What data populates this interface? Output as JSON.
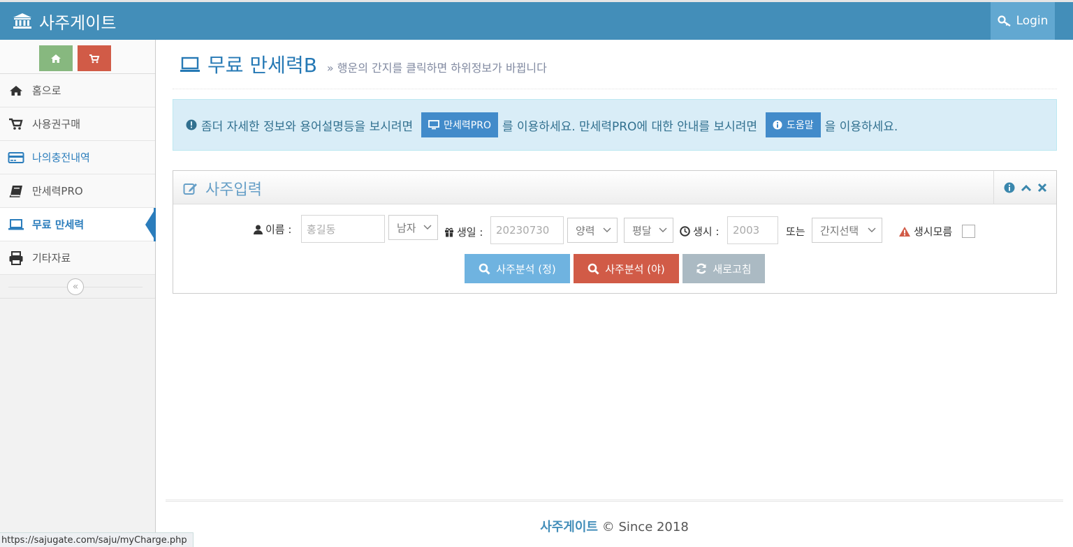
{
  "header": {
    "brand": "사주게이트",
    "login_label": "Login"
  },
  "sidebar": {
    "items": [
      {
        "label": "홈으로",
        "icon": "home-icon"
      },
      {
        "label": "사용권구매",
        "icon": "cart-icon"
      },
      {
        "label": "나의충전내역",
        "icon": "credit-card-icon"
      },
      {
        "label": "만세력PRO",
        "icon": "book-icon"
      },
      {
        "label": "무료 만세력",
        "icon": "laptop-icon",
        "active": true
      },
      {
        "label": "기타자료",
        "icon": "print-icon"
      }
    ],
    "collapse_glyph": "«"
  },
  "page": {
    "title": "무료 만세력B",
    "subtitle": "» 행운의 간지를 클릭하면 하위정보가 바뀝니다"
  },
  "alert": {
    "text1": "좀더 자세한 정보와 용어설명등을 보시려면",
    "pro_button": "만세력PRO",
    "text2": "를 이용하세요. 만세력PRO에 대한 안내를 보시려면",
    "help_button": "도움말",
    "text3": "을 이용하세요."
  },
  "widget": {
    "title": "사주입력"
  },
  "form": {
    "name_label": "이름 :",
    "name_placeholder": "홍길동",
    "gender": "남자",
    "birth_label": "생일 :",
    "birth_placeholder": "20230730",
    "calendar": "양력",
    "month_type": "평달",
    "time_label": "생시 :",
    "time_placeholder": "2003",
    "or_label": "또는",
    "ganji_select": "간지선택",
    "unknown_label": "생시모름"
  },
  "buttons": {
    "analyze_day": "사주분석 (정)",
    "analyze_night": "사주분석 (야)",
    "refresh": "새로고침"
  },
  "footer": {
    "brand": "사주게이트",
    "since": "© Since 2018"
  },
  "status_url": "https://sajugate.com/saju/myCharge.php",
  "colors": {
    "topbar": "#438eb9",
    "active": "#2b7dbc",
    "green": "#87b87f",
    "red": "#d15b47",
    "light_blue": "#6fb3e0",
    "grey": "#abbac3",
    "alert_bg": "#d9edf7"
  }
}
